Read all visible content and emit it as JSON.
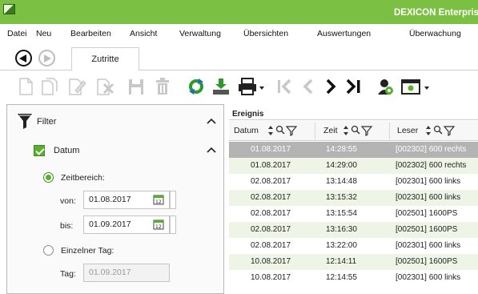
{
  "app": {
    "title": "DEXICON Enterprise",
    "brand_color": "#7bc043"
  },
  "menu": [
    "Datei",
    "Neu",
    "Bearbeiten",
    "Ansicht",
    "Verwaltung",
    "Übersichten",
    "Auswertungen",
    "Überwachung"
  ],
  "nav": {
    "active_tab": "Zutritte"
  },
  "toolbar": {
    "buttons": [
      "new-document-icon",
      "copy-document-icon",
      "edit-document-icon",
      "delete-document-icon",
      "save-icon",
      "trash-icon",
      "refresh-icon",
      "download-icon",
      "print-icon",
      "first-record-icon",
      "previous-record-icon",
      "next-record-icon",
      "last-record-icon",
      "user-settings-icon",
      "window-settings-icon"
    ]
  },
  "filter": {
    "title": "Filter",
    "datum": {
      "label": "Datum",
      "checked": true,
      "zeitbereich_label": "Zeitbereich:",
      "von_label": "von:",
      "von_value": "01.08.2017",
      "bis_label": "bis:",
      "bis_value": "01.09.2017",
      "einzelner_tag_label": "Einzelner Tag:",
      "tag_label": "Tag:",
      "tag_value": "01.09.2017"
    }
  },
  "grid": {
    "title": "Ereignis",
    "columns": [
      "Datum",
      "Zeit",
      "Leser"
    ],
    "rows": [
      {
        "datum": "01.08.2017",
        "zeit": "14:28:55",
        "leser": "[002302] 600 rechts"
      },
      {
        "datum": "01.08.2017",
        "zeit": "14:29:00",
        "leser": "[002302] 600 rechts"
      },
      {
        "datum": "02.08.2017",
        "zeit": "13:14:48",
        "leser": "[002301] 600 links"
      },
      {
        "datum": "02.08.2017",
        "zeit": "13:15:32",
        "leser": "[002301] 600 links"
      },
      {
        "datum": "02.08.2017",
        "zeit": "13:15:54",
        "leser": "[002501] 1600PS"
      },
      {
        "datum": "02.08.2017",
        "zeit": "13:16:30",
        "leser": "[002501] 1600PS"
      },
      {
        "datum": "02.08.2017",
        "zeit": "13:22:00",
        "leser": "[002301] 600 links"
      },
      {
        "datum": "10.08.2017",
        "zeit": "12:14:11",
        "leser": "[002501] 1600PS"
      },
      {
        "datum": "10.08.2017",
        "zeit": "12:14:55",
        "leser": "[002301] 600 links"
      }
    ]
  }
}
